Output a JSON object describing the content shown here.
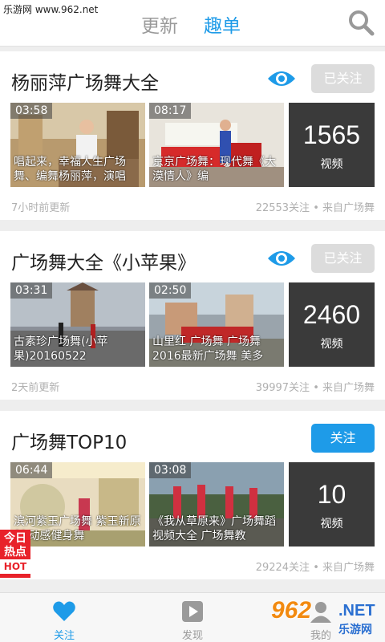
{
  "watermark": "乐游网 www.962.net",
  "header": {
    "tabs": [
      {
        "label": "更新",
        "active": false
      },
      {
        "label": "趣单",
        "active": true
      }
    ],
    "search_icon": "search-icon"
  },
  "colors": {
    "accent": "#1e9be8",
    "followed_btn": "#dcdcdc",
    "hot": "#e8222a"
  },
  "playlists": [
    {
      "title": "杨丽萍广场舞大全",
      "follow_label": "已关注",
      "followed": true,
      "videos": [
        {
          "duration": "03:58",
          "title": "唱起来，幸福人生广场舞、编舞杨丽萍，演唱"
        },
        {
          "duration": "08:17",
          "title": "京京广场舞：现代舞《大漠情人》编"
        }
      ],
      "count": "1565",
      "count_label": "视频",
      "updated": "7小时前更新",
      "meta": "22553关注 • 来自广场舞"
    },
    {
      "title": "广场舞大全《小苹果》",
      "follow_label": "已关注",
      "followed": true,
      "videos": [
        {
          "duration": "03:31",
          "title": "古素珍广场舞(小苹果)20160522"
        },
        {
          "duration": "02:50",
          "title": "山里红 广场舞 广场舞2016最新广场舞 美多"
        }
      ],
      "count": "2460",
      "count_label": "视频",
      "updated": "2天前更新",
      "meta": "39997关注 • 来自广场舞"
    },
    {
      "title": "广场舞TOP10",
      "follow_label": "关注",
      "followed": false,
      "videos": [
        {
          "duration": "06:44",
          "title": "滨河紫玉广场舞  紫玉新原创  动感健身舞"
        },
        {
          "duration": "03:08",
          "title": "《我从草原来》广场舞蹈视频大全 广场舞教"
        }
      ],
      "count": "10",
      "count_label": "视频",
      "updated": "",
      "meta": "29224关注 • 来自广场舞"
    }
  ],
  "hot_badge": {
    "line1": "今日",
    "line2": "热点",
    "line3": "HOT"
  },
  "bottom_nav": [
    {
      "label": "关注",
      "icon": "heart-icon",
      "active": true
    },
    {
      "label": "发现",
      "icon": "play-icon",
      "active": false
    },
    {
      "label": "我的",
      "icon": "user-icon",
      "active": false
    }
  ],
  "logo": {
    "num": "962",
    "net": ".NET",
    "cn": "乐游网"
  }
}
